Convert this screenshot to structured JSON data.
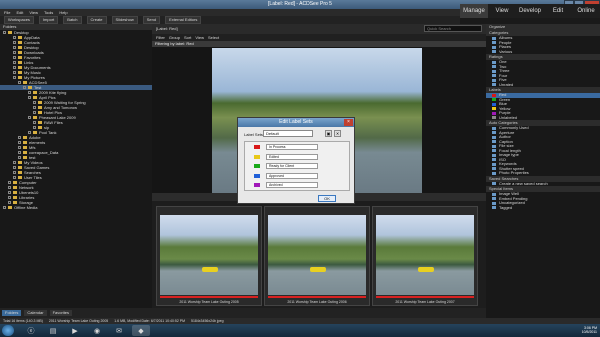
{
  "window": {
    "title": "[Label: Red] - ACDSee Pro 5"
  },
  "menu": [
    "File",
    "Edit",
    "View",
    "Tools",
    "Help"
  ],
  "modes": [
    "Manage",
    "View",
    "Develop",
    "Edit",
    "Online"
  ],
  "toolbar": [
    "Workspaces",
    "Import",
    "Batch",
    "Create",
    "Slideshow",
    "Send",
    "External Editors"
  ],
  "folders": {
    "header": "Folders",
    "items": [
      {
        "label": "Desktop",
        "depth": 0
      },
      {
        "label": "AppData",
        "depth": 2
      },
      {
        "label": "Contacts",
        "depth": 2
      },
      {
        "label": "Desktop",
        "depth": 2
      },
      {
        "label": "Downloads",
        "depth": 2
      },
      {
        "label": "Favorites",
        "depth": 2
      },
      {
        "label": "Links",
        "depth": 2
      },
      {
        "label": "My Documents",
        "depth": 2
      },
      {
        "label": "My Music",
        "depth": 2
      },
      {
        "label": "My Pictures",
        "depth": 2
      },
      {
        "label": "ACDSee5",
        "depth": 3
      },
      {
        "label": "Test",
        "depth": 4,
        "selected": true
      },
      {
        "label": "2009 Kite flying",
        "depth": 5
      },
      {
        "label": "April Pics",
        "depth": 5
      },
      {
        "label": "2009 Waiting for Spring",
        "depth": 6
      },
      {
        "label": "Amy and Tomorow",
        "depth": 6
      },
      {
        "label": "Hotel Pics",
        "depth": 6
      },
      {
        "label": "Pheasant Lake 2009",
        "depth": 5
      },
      {
        "label": "RAW Files",
        "depth": 6
      },
      {
        "label": "sip",
        "depth": 6
      },
      {
        "label": "Pool Tank",
        "depth": 5
      },
      {
        "label": "Adobe",
        "depth": 3
      },
      {
        "label": "elements",
        "depth": 3
      },
      {
        "label": "Mfs",
        "depth": 3
      },
      {
        "label": "coreapace_Data",
        "depth": 3
      },
      {
        "label": "test",
        "depth": 3
      },
      {
        "label": "My Videos",
        "depth": 2
      },
      {
        "label": "Saved Games",
        "depth": 2
      },
      {
        "label": "Searches",
        "depth": 2
      },
      {
        "label": "User Tiles",
        "depth": 2
      },
      {
        "label": "Computer",
        "depth": 1
      },
      {
        "label": "Network",
        "depth": 1
      },
      {
        "label": "Ubenets10",
        "depth": 1
      },
      {
        "label": "Libraries",
        "depth": 1
      },
      {
        "label": "Storage",
        "depth": 1
      },
      {
        "label": "Offline Media",
        "depth": 0
      }
    ]
  },
  "left_tabs": [
    "Folders",
    "Calendar",
    "Favorites"
  ],
  "browser": {
    "label": "[Label: Red]",
    "search_placeholder": "Quick Search",
    "filter_items": [
      "Filter",
      "Group",
      "Sort",
      "View",
      "Select"
    ],
    "breadcrumb": "Filtering by label: Red"
  },
  "thumbnails": [
    "2011 Worship Team Lake Outing 2005",
    "2011 Worship Team Lake Outing 2006",
    "2011 Worship Team Lake Outing 2007"
  ],
  "dialog": {
    "title": "Edit Label Sets",
    "set_label": "Label Sets:",
    "set_value": "Default",
    "ok": "OK",
    "labels": [
      {
        "name": "In Process",
        "color": "#d81818"
      },
      {
        "name": "Edited",
        "color": "#e8c818"
      },
      {
        "name": "Ready for Client",
        "color": "#18a818"
      },
      {
        "name": "Approved",
        "color": "#2060d8"
      },
      {
        "name": "Archived",
        "color": "#a018b8"
      }
    ]
  },
  "organize": {
    "header": "Organize",
    "categories_header": "Categories",
    "categories": [
      "Albums",
      "People",
      "Places",
      "Various"
    ],
    "ratings_header": "Ratings",
    "ratings": [
      "One",
      "Two",
      "Three",
      "Four",
      "Five",
      "Unrated"
    ],
    "labels_header": "Labels",
    "labels": [
      {
        "name": "Red",
        "color": "#d81818",
        "selected": true
      },
      {
        "name": "Green",
        "color": "#18a818"
      },
      {
        "name": "Blue",
        "color": "#2060d8"
      },
      {
        "name": "Yellow",
        "color": "#e8c818"
      },
      {
        "name": "Purple",
        "color": "#a018b8"
      },
      {
        "name": "Unlabeled",
        "color": "#888888"
      }
    ],
    "auto_header": "Auto Categories",
    "auto": [
      "Commonly Used",
      "Aperture",
      "Author",
      "Caption",
      "File size",
      "Focal length",
      "Image type",
      "ISO",
      "Keywords",
      "Shutter speed",
      "Photo Properties"
    ],
    "saved_header": "Saved Searches",
    "saved": [
      "Create a new saved search"
    ],
    "special_header": "Special Items",
    "special": [
      "Image Well",
      "Embed Pending",
      "Uncategorized",
      "Tagged"
    ]
  },
  "status": [
    "Total 16 items  (140.3 MB)",
    "2011 Worship Team Lake Outing 2005",
    "1.6 MB, Modified Date: 6/7/2011 10:40:52 PM",
    "5184x3456x24b jpeg"
  ],
  "clock": {
    "time": "3:06 PM",
    "date": "10/5/2011"
  }
}
